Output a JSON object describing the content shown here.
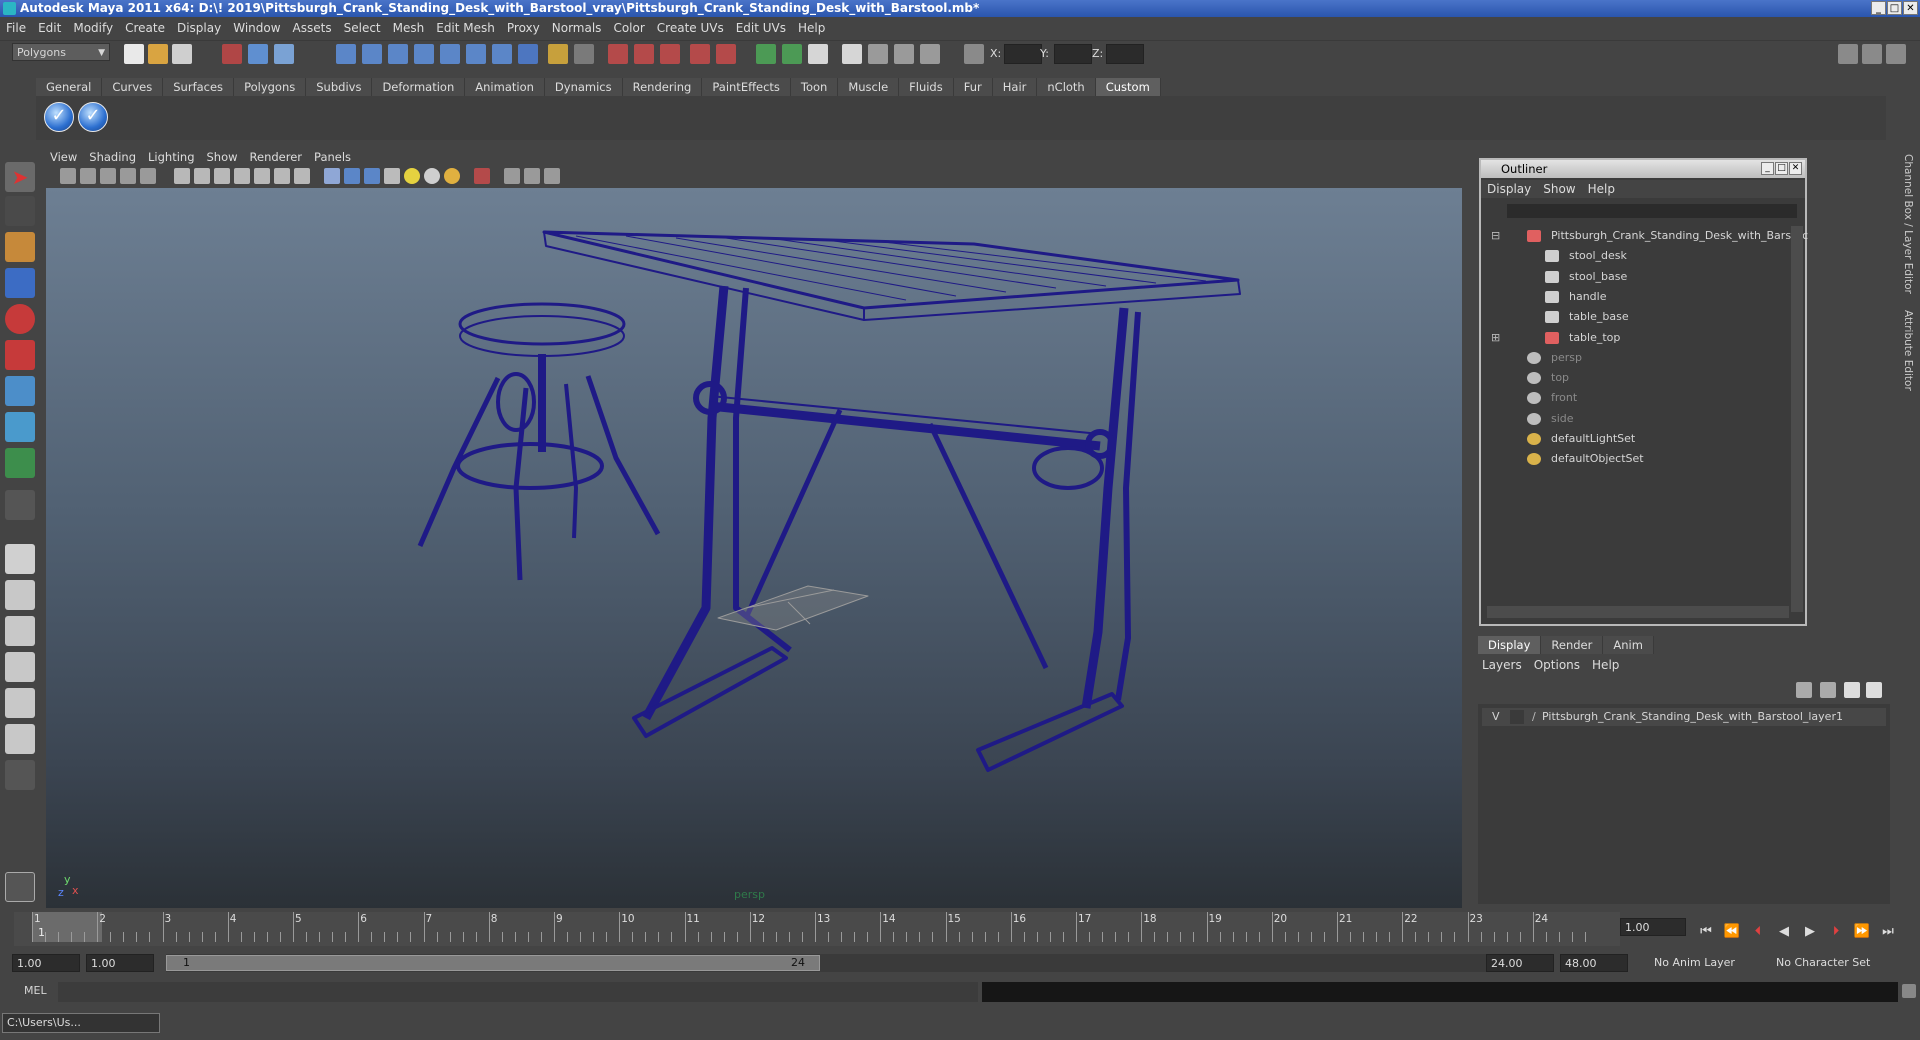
{
  "window": {
    "title": "Autodesk Maya 2011 x64: D:\\! 2019\\Pittsburgh_Crank_Standing_Desk_with_Barstool_vray\\Pittsburgh_Crank_Standing_Desk_with_Barstool.mb*"
  },
  "menubar": [
    "File",
    "Edit",
    "Modify",
    "Create",
    "Display",
    "Window",
    "Assets",
    "Select",
    "Mesh",
    "Edit Mesh",
    "Proxy",
    "Normals",
    "Color",
    "Create UVs",
    "Edit UVs",
    "Help"
  ],
  "status": {
    "mode": "Polygons",
    "x_label": "X:",
    "y_label": "Y:",
    "z_label": "Z:"
  },
  "shelf": {
    "tabs": [
      "General",
      "Curves",
      "Surfaces",
      "Polygons",
      "Subdivs",
      "Deformation",
      "Animation",
      "Dynamics",
      "Rendering",
      "PaintEffects",
      "Toon",
      "Muscle",
      "Fluids",
      "Fur",
      "Hair",
      "nCloth",
      "Custom"
    ],
    "active_tab": "Custom"
  },
  "viewport": {
    "menu": [
      "View",
      "Shading",
      "Lighting",
      "Show",
      "Renderer",
      "Panels"
    ],
    "camera": "persp",
    "axis_y": "y",
    "axis_x": "x",
    "axis_z": "z",
    "wire_color": "#1f1a86"
  },
  "channel_box_label": "Channel Box / Layer Editor",
  "attribute_editor_label": "Attribute Editor",
  "outliner": {
    "title": "Outliner",
    "menu": [
      "Display",
      "Show",
      "Help"
    ],
    "items": [
      {
        "label": "Pittsburgh_Crank_Standing_Desk_with_Barstoc",
        "indent": 0,
        "dim": false,
        "icon": "group"
      },
      {
        "label": "stool_desk",
        "indent": 1,
        "dim": false,
        "icon": "mesh"
      },
      {
        "label": "stool_base",
        "indent": 1,
        "dim": false,
        "icon": "mesh"
      },
      {
        "label": "handle",
        "indent": 1,
        "dim": false,
        "icon": "mesh"
      },
      {
        "label": "table_base",
        "indent": 1,
        "dim": false,
        "icon": "mesh"
      },
      {
        "label": "table_top",
        "indent": 1,
        "dim": false,
        "icon": "group"
      },
      {
        "label": "persp",
        "indent": 0,
        "dim": true,
        "icon": "camera"
      },
      {
        "label": "top",
        "indent": 0,
        "dim": true,
        "icon": "camera"
      },
      {
        "label": "front",
        "indent": 0,
        "dim": true,
        "icon": "camera"
      },
      {
        "label": "side",
        "indent": 0,
        "dim": true,
        "icon": "camera"
      },
      {
        "label": "defaultLightSet",
        "indent": 0,
        "dim": false,
        "icon": "set"
      },
      {
        "label": "defaultObjectSet",
        "indent": 0,
        "dim": false,
        "icon": "set"
      }
    ]
  },
  "layers": {
    "tabs": [
      "Display",
      "Render",
      "Anim"
    ],
    "active_tab": "Display",
    "menu": [
      "Layers",
      "Options",
      "Help"
    ],
    "visibility_flag": "V",
    "layer_name": "Pittsburgh_Crank_Standing_Desk_with_Barstool_layer1"
  },
  "timeline": {
    "ticks": [
      "1",
      "2",
      "3",
      "4",
      "5",
      "6",
      "7",
      "8",
      "9",
      "10",
      "11",
      "12",
      "13",
      "14",
      "15",
      "16",
      "17",
      "18",
      "19",
      "20",
      "21",
      "22",
      "23",
      "24"
    ],
    "current_frame": "1",
    "current_time": "1.00",
    "start_time": "1.00",
    "playback_start": "1.00",
    "range_start_label": "1",
    "range_end_label": "24",
    "playback_end": "24.00",
    "end_time": "48.00",
    "anim_layer": "No Anim Layer",
    "character_set": "No Character Set"
  },
  "command": {
    "label": "MEL"
  },
  "taskbar": {
    "item": "C:\\Users\\Us..."
  }
}
